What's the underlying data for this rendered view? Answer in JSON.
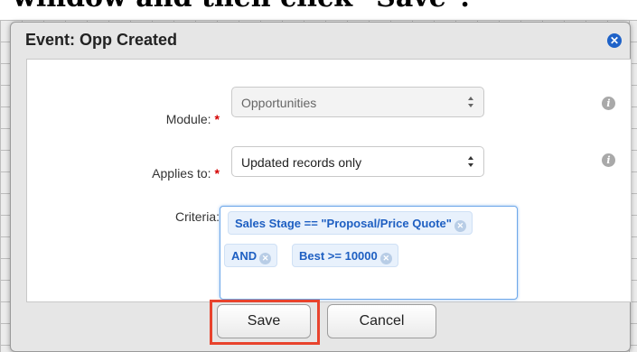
{
  "caption": "window and then click \"Save\".",
  "dialog": {
    "title": "Event: Opp Created",
    "close_glyph": "✕"
  },
  "form": {
    "module": {
      "label": "Module:",
      "required_mark": "*",
      "value": "Opportunities",
      "disabled": true
    },
    "applies_to": {
      "label": "Applies to:",
      "required_mark": "*",
      "value": "Updated records only"
    },
    "criteria": {
      "label": "Criteria:",
      "tokens": [
        {
          "text": "Sales Stage == \"Proposal/Price Quote\""
        },
        {
          "text": "AND"
        },
        {
          "text": "Best >= 10000"
        }
      ]
    },
    "info_glyph": "i"
  },
  "footer": {
    "save_label": "Save",
    "cancel_label": "Cancel"
  },
  "colors": {
    "accent": "#1e62c8",
    "token_text": "#1e5fc2",
    "required": "#d40000",
    "highlight": "#e8432d"
  },
  "icons": {
    "close": "close-icon",
    "info": "info-icon",
    "select_arrows": "select-arrows-icon",
    "token_remove": "remove-token-icon"
  }
}
